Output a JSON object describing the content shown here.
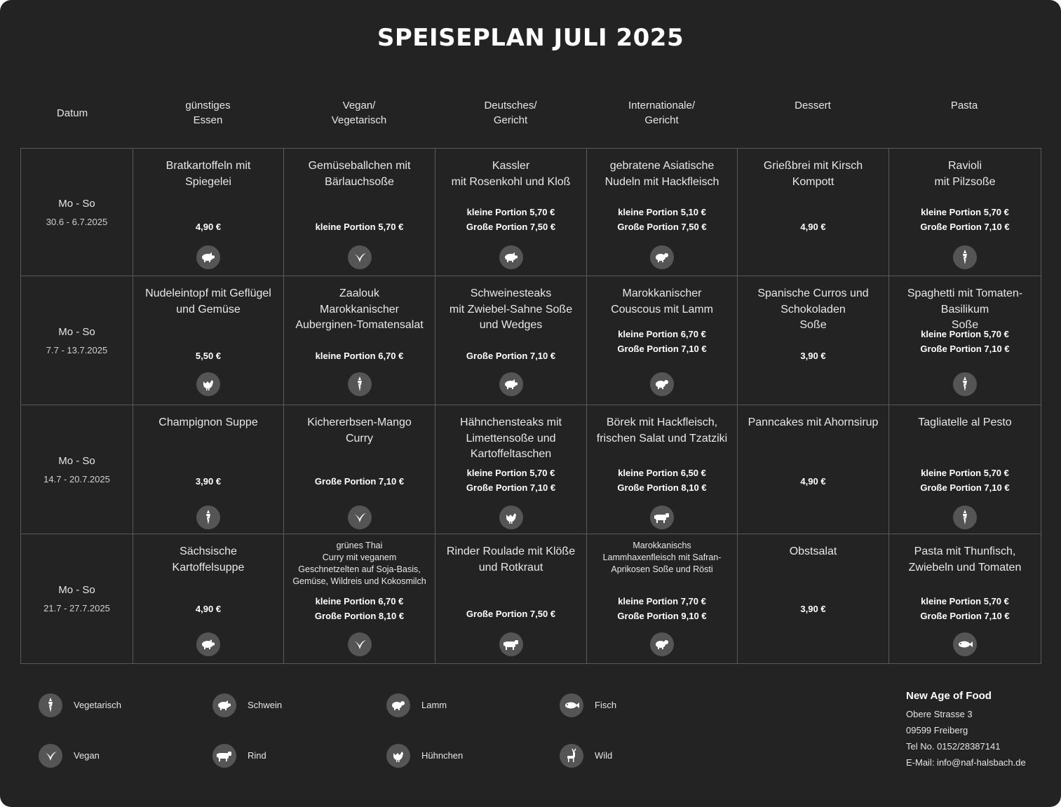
{
  "title": "SPEISEPLAN JULI 2025",
  "headers": [
    "Datum",
    "günstiges\nEssen",
    "Vegan/\nVegetarisch",
    "Deutsches/\nGericht",
    "Internationale/\nGericht",
    "Dessert",
    "Pasta"
  ],
  "weeks": [
    {
      "label": "Mo - So",
      "range": "30.6 - 6.7.2025",
      "dishes": [
        {
          "name": "Bratkartoffeln mit\nSpiegelei",
          "prices": [
            "4,90 €"
          ],
          "icon": "pig-icon"
        },
        {
          "name": "Gemüseballchen mit\nBärlauchsoße",
          "prices": [
            "kleine Portion 5,70 €"
          ],
          "icon": "leaf-icon"
        },
        {
          "name": "Kassler\nmit Rosenkohl und Kloß",
          "prices": [
            "kleine Portion 5,70 €",
            "Große Portion 7,50 €"
          ],
          "icon": "pig-icon"
        },
        {
          "name": "gebratene Asiatische\nNudeln mit Hackfleisch",
          "prices": [
            "kleine Portion 5,10 €",
            "Große Portion 7,50 €"
          ],
          "icon": "sheep-icon"
        },
        {
          "name": "Grießbrei mit Kirsch\nKompott",
          "prices": [
            "4,90 €"
          ],
          "icon": ""
        },
        {
          "name": "Ravioli\nmit Pilzsoße",
          "prices": [
            "kleine Portion 5,70 €",
            "Große Portion 7,10 €"
          ],
          "icon": "carrot-icon"
        }
      ]
    },
    {
      "label": "Mo - So",
      "range": "7.7 - 13.7.2025",
      "dishes": [
        {
          "name": "Nudeleintopf mit Geflügel\nund Gemüse",
          "prices": [
            "5,50 €"
          ],
          "icon": "chicken-icon"
        },
        {
          "name": "Zaalouk\nMarokkanischer\nAuberginen-Tomatensalat",
          "prices": [
            "kleine Portion 6,70 €"
          ],
          "icon": "carrot-icon"
        },
        {
          "name": "Schweinesteaks\nmit Zwiebel-Sahne Soße\nund Wedges",
          "prices": [
            "Große Portion 7,10 €"
          ],
          "icon": "pig-icon"
        },
        {
          "name": "Marokkanischer\nCouscous mit Lamm",
          "prices": [
            "kleine Portion 6,70 €",
            "Große Portion 7,10 €"
          ],
          "icon": "sheep-icon"
        },
        {
          "name": "Spanische Curros und\nSchokoladen\nSoße",
          "prices": [
            "3,90 €"
          ],
          "icon": ""
        },
        {
          "name": "Spaghetti mit Tomaten-\nBasilikum\nSoße",
          "prices": [
            "kleine Portion 5,70 €",
            "Große Portion 7,10 €"
          ],
          "icon": "carrot-icon"
        }
      ]
    },
    {
      "label": "Mo - So",
      "range": "14.7 - 20.7.2025",
      "dishes": [
        {
          "name": "Champignon Suppe",
          "prices": [
            "3,90 €"
          ],
          "icon": "carrot-icon"
        },
        {
          "name": "Kichererbsen-Mango\nCurry",
          "prices": [
            "Große Portion 7,10 €"
          ],
          "icon": "leaf-icon"
        },
        {
          "name": "Hähnchensteaks mit\nLimettensoße und\nKartoffeltaschen",
          "prices": [
            "kleine Portion 5,70 €",
            "Große Portion 7,10 €"
          ],
          "icon": "chicken-icon"
        },
        {
          "name": "Börek mit Hackfleisch,\nfrischen Salat und Tzatziki",
          "prices": [
            "kleine Portion 6,50 €",
            "Große Portion 8,10 €"
          ],
          "icon": "cow-icon"
        },
        {
          "name": "Panncakes mit Ahornsirup",
          "prices": [
            "4,90 €"
          ],
          "icon": ""
        },
        {
          "name": "Tagliatelle al Pesto",
          "prices": [
            "kleine Portion 5,70 €",
            "Große Portion 7,10 €"
          ],
          "icon": "carrot-icon"
        }
      ]
    },
    {
      "label": "Mo - So",
      "range": "21.7 - 27.7.2025",
      "dishes": [
        {
          "name": "Sächsische\nKartoffelsuppe",
          "prices": [
            "4,90 €"
          ],
          "icon": "pig-icon"
        },
        {
          "name": "grünes Thai\nCurry mit veganem\nGeschnetzelten auf Soja-Basis,\nGemüse, Wildreis und Kokosmilch",
          "small": true,
          "prices": [
            "kleine Portion 6,70 €",
            "Große Portion 8,10 €"
          ],
          "icon": "leaf-icon"
        },
        {
          "name": "Rinder Roulade mit Klöße\nund Rotkraut",
          "prices": [
            "Große Portion 7,50 €"
          ],
          "icon": "cow-icon"
        },
        {
          "name": "Marokkanischs\nLammhaxenfleisch mit Safran-\nAprikosen Soße und Rösti",
          "small": true,
          "prices": [
            "kleine Portion 7,70 €",
            "Große Portion 9,10 €"
          ],
          "icon": "sheep-icon"
        },
        {
          "name": "Obstsalat",
          "prices": [
            "3,90 €"
          ],
          "icon": ""
        },
        {
          "name": "Pasta mit Thunfisch,\nZwiebeln und Tomaten",
          "prices": [
            "kleine Portion 5,70 €",
            "Große Portion 7,10 €"
          ],
          "icon": "fish-icon"
        }
      ]
    }
  ],
  "legend": [
    {
      "icon": "carrot-icon",
      "label": "Vegetarisch"
    },
    {
      "icon": "pig-icon",
      "label": "Schwein"
    },
    {
      "icon": "sheep-icon",
      "label": "Lamm"
    },
    {
      "icon": "fish-icon",
      "label": "Fisch"
    },
    {
      "icon": "leaf-icon",
      "label": "Vegan"
    },
    {
      "icon": "cow-icon",
      "label": "Rind"
    },
    {
      "icon": "chicken-icon",
      "label": "Hühnchen"
    },
    {
      "icon": "deer-icon",
      "label": "Wild"
    }
  ],
  "contact": {
    "name": "New Age of Food",
    "street": "Obere Strasse 3",
    "city": "09599 Freiberg",
    "phone": "Tel No. 0152/28387141",
    "email": "E-Mail: info@naf-halsbach.de"
  }
}
